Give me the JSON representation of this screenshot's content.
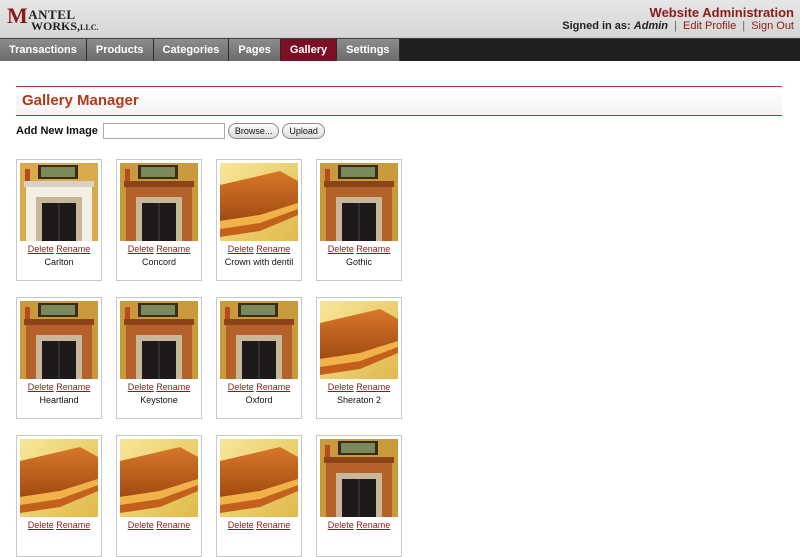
{
  "brand": {
    "logo_line1_initial": "M",
    "logo_line1_rest": "ANTEL",
    "logo_line2": "WORKS,",
    "logo_llc": "LLC."
  },
  "admin": {
    "title": "Website Administration",
    "signed_in_label": "Signed in as:",
    "user": "Admin",
    "edit_profile": "Edit Profile",
    "sign_out": "Sign Out",
    "separator": "|"
  },
  "nav": [
    {
      "label": "Transactions",
      "active": false
    },
    {
      "label": "Products",
      "active": false
    },
    {
      "label": "Categories",
      "active": false
    },
    {
      "label": "Pages",
      "active": false
    },
    {
      "label": "Gallery",
      "active": true
    },
    {
      "label": "Settings",
      "active": false
    }
  ],
  "gallery": {
    "title": "Gallery Manager",
    "add_label": "Add New Image",
    "browse_label": "Browse...",
    "upload_label": "Upload",
    "delete_label": "Delete",
    "rename_label": "Rename",
    "items": [
      {
        "name": "Carlton",
        "kind": "fireplace-white"
      },
      {
        "name": "Concord",
        "kind": "fireplace-wood"
      },
      {
        "name": "Crown with dentil",
        "kind": "crown"
      },
      {
        "name": "Gothic",
        "kind": "fireplace-wood"
      },
      {
        "name": "Heartland",
        "kind": "fireplace-wood"
      },
      {
        "name": "Keystone",
        "kind": "fireplace-wood"
      },
      {
        "name": "Oxford",
        "kind": "fireplace-wood"
      },
      {
        "name": "Sheraton 2",
        "kind": "crown"
      },
      {
        "name": "",
        "kind": "crown"
      },
      {
        "name": "",
        "kind": "crown"
      },
      {
        "name": "",
        "kind": "crown"
      },
      {
        "name": "",
        "kind": "fireplace-wood"
      }
    ]
  },
  "colors": {
    "accent": "#8c1a1a",
    "nav_active": "#7b0f24",
    "title": "#b03a1a"
  }
}
